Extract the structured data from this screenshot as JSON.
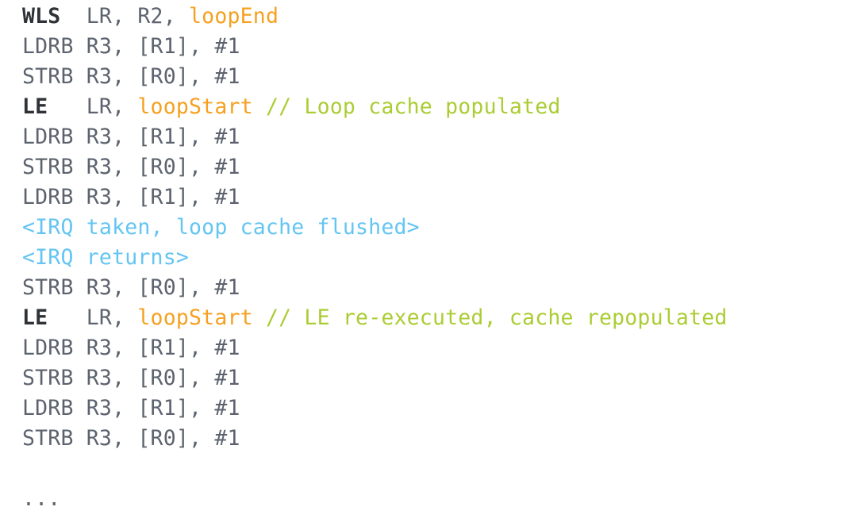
{
  "listing": {
    "language": "arm-assembly",
    "background_color": "#ffffff",
    "colors": {
      "mnemonic_bold": "#2f3338",
      "plain": "#5c636e",
      "label": "#f6a01f",
      "comment": "#aacd34",
      "event": "#64c5f2"
    },
    "lines": [
      {
        "id": "line-1",
        "text": "WLS  LR, R2, loopEnd",
        "tokens": [
          {
            "text": "WLS  ",
            "role": "mnemonic_bold"
          },
          {
            "text": "LR, R2, ",
            "role": "plain"
          },
          {
            "text": "loopEnd",
            "role": "label"
          }
        ]
      },
      {
        "id": "line-2",
        "text": "LDRB R3, [R1], #1",
        "tokens": [
          {
            "text": "LDRB R3, [R1], #1",
            "role": "plain"
          }
        ]
      },
      {
        "id": "line-3",
        "text": "STRB R3, [R0], #1",
        "tokens": [
          {
            "text": "STRB R3, [R0], #1",
            "role": "plain"
          }
        ]
      },
      {
        "id": "line-4",
        "text": "LE   LR, loopStart // Loop cache populated",
        "tokens": [
          {
            "text": "LE   ",
            "role": "mnemonic_bold"
          },
          {
            "text": "LR, ",
            "role": "plain"
          },
          {
            "text": "loopStart",
            "role": "label"
          },
          {
            "text": " ",
            "role": "plain"
          },
          {
            "text": "// Loop cache populated",
            "role": "comment"
          }
        ]
      },
      {
        "id": "line-5",
        "text": "LDRB R3, [R1], #1",
        "tokens": [
          {
            "text": "LDRB R3, [R1], #1",
            "role": "plain"
          }
        ]
      },
      {
        "id": "line-6",
        "text": "STRB R3, [R0], #1",
        "tokens": [
          {
            "text": "STRB R3, [R0], #1",
            "role": "plain"
          }
        ]
      },
      {
        "id": "line-7",
        "text": "LDRB R3, [R1], #1",
        "tokens": [
          {
            "text": "LDRB R3, [R1], #1",
            "role": "plain"
          }
        ]
      },
      {
        "id": "line-8",
        "text": "<IRQ taken, loop cache flushed>",
        "tokens": [
          {
            "text": "<IRQ taken, loop cache flushed>",
            "role": "event"
          }
        ]
      },
      {
        "id": "line-9",
        "text": "<IRQ returns>",
        "tokens": [
          {
            "text": "<IRQ returns>",
            "role": "event"
          }
        ]
      },
      {
        "id": "line-10",
        "text": "STRB R3, [R0], #1",
        "tokens": [
          {
            "text": "STRB R3, [R0], #1",
            "role": "plain"
          }
        ]
      },
      {
        "id": "line-11",
        "text": "LE   LR, loopStart // LE re-executed, cache repopulated",
        "tokens": [
          {
            "text": "LE   ",
            "role": "mnemonic_bold"
          },
          {
            "text": "LR, ",
            "role": "plain"
          },
          {
            "text": "loopStart",
            "role": "label"
          },
          {
            "text": " ",
            "role": "plain"
          },
          {
            "text": "// LE re-executed, cache repopulated",
            "role": "comment"
          }
        ]
      },
      {
        "id": "line-12",
        "text": "LDRB R3, [R1], #1",
        "tokens": [
          {
            "text": "LDRB R3, [R1], #1",
            "role": "plain"
          }
        ]
      },
      {
        "id": "line-13",
        "text": "STRB R3, [R0], #1",
        "tokens": [
          {
            "text": "STRB R3, [R0], #1",
            "role": "plain"
          }
        ]
      },
      {
        "id": "line-14",
        "text": "LDRB R3, [R1], #1",
        "tokens": [
          {
            "text": "LDRB R3, [R1], #1",
            "role": "plain"
          }
        ]
      },
      {
        "id": "line-15",
        "text": "STRB R3, [R0], #1",
        "tokens": [
          {
            "text": "STRB R3, [R0], #1",
            "role": "plain"
          }
        ]
      },
      {
        "id": "line-16",
        "text": "",
        "tokens": []
      },
      {
        "id": "line-17",
        "text": "...",
        "tokens": [
          {
            "text": "...",
            "role": "ellipsis"
          }
        ]
      }
    ]
  }
}
